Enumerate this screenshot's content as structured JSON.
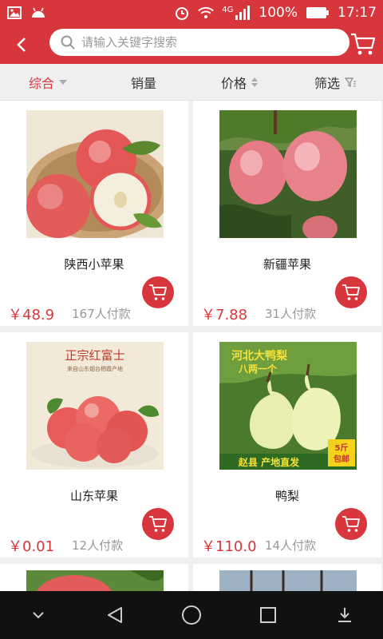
{
  "status_bar": {
    "signal_label": "4G",
    "battery": "100%",
    "time": "17:17"
  },
  "search": {
    "placeholder": "请输入关键字搜索"
  },
  "filters": [
    {
      "label": "综合",
      "active": true
    },
    {
      "label": "销量"
    },
    {
      "label": "价格"
    },
    {
      "label": "筛选"
    }
  ],
  "products": [
    {
      "name": "陕西小苹果",
      "price": "￥48.9",
      "sold": "167人付款"
    },
    {
      "name": "新疆苹果",
      "price": "￥7.88",
      "sold": "31人付款"
    },
    {
      "name": "山东苹果",
      "price": "￥0.01",
      "sold": "12人付款",
      "image_text": {
        "headline": "正宗红富士",
        "sub": "来自山东烟台栖霞产地"
      }
    },
    {
      "name": "鸭梨",
      "price": "￥110.0",
      "sold": "14人付款",
      "image_text": {
        "headline": "河北大鸭梨",
        "sub": "八两一个",
        "footer": "赵县 产地直发",
        "badge_top": "5斤",
        "badge_bottom": "包邮"
      }
    }
  ],
  "colors": {
    "accent": "#d8363d",
    "price": "#d8363d",
    "nav_bg": "#111111"
  }
}
